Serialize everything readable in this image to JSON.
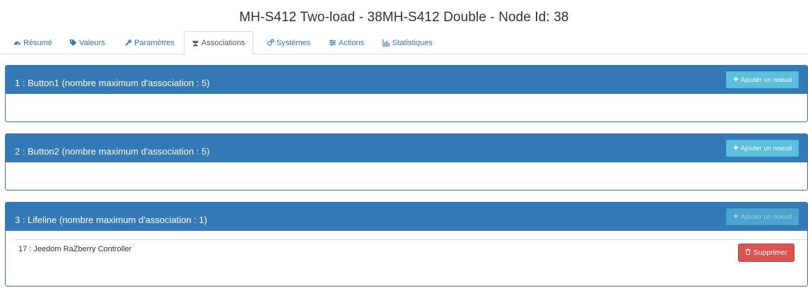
{
  "header": {
    "title": "MH-S412 Two-load - 38MH-S412 Double - Node Id: 38"
  },
  "tabs": [
    {
      "label": "Résumé",
      "icon": "dashboard-icon",
      "active": false
    },
    {
      "label": "Valeurs",
      "icon": "tag-icon",
      "active": false
    },
    {
      "label": "Paramètres",
      "icon": "wrench-icon",
      "active": false
    },
    {
      "label": "Associations",
      "icon": "users-icon",
      "active": true
    },
    {
      "label": "Systèmes",
      "icon": "cogs-icon",
      "active": false
    },
    {
      "label": "Actions",
      "icon": "sliders-icon",
      "active": false
    },
    {
      "label": "Statistiques",
      "icon": "bar-chart-icon",
      "active": false
    }
  ],
  "groups": [
    {
      "title": "1 : Button1 (nombre maximum d'association : 5)",
      "add_label": "Ajouter un noeud",
      "add_disabled": false,
      "nodes": []
    },
    {
      "title": "2 : Button2 (nombre maximum d'association : 5)",
      "add_label": "Ajouter un noeud",
      "add_disabled": false,
      "nodes": []
    },
    {
      "title": "3 : Lifeline (nombre maximum d'association : 1)",
      "add_label": "Ajouter un noeud",
      "add_disabled": true,
      "nodes": [
        {
          "label": "17 : Jeedom RaZberry Controller",
          "delete_label": "Supprimer"
        }
      ]
    }
  ],
  "colors": {
    "primary": "#337ab7",
    "info": "#5bc0de",
    "danger": "#d9534f"
  }
}
